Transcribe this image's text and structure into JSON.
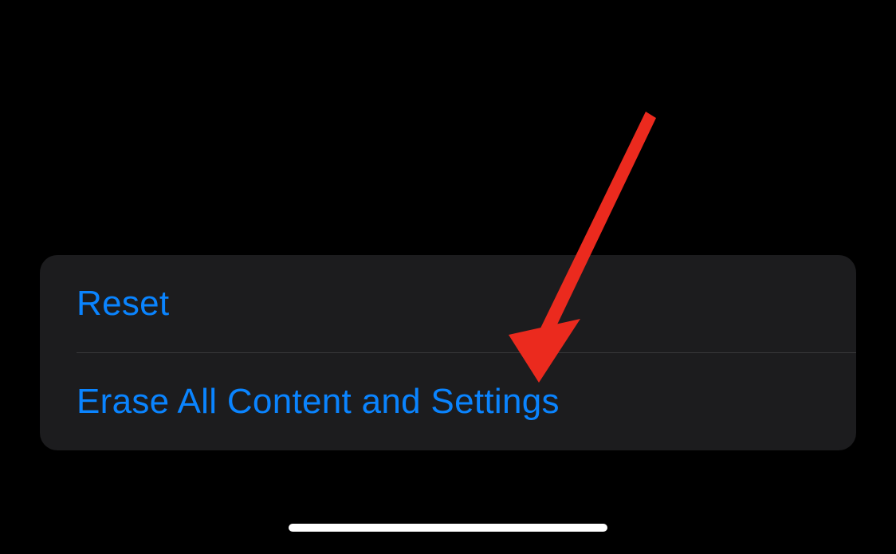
{
  "settings": {
    "group": {
      "reset_label": "Reset",
      "erase_label": "Erase All Content and Settings"
    }
  },
  "annotation": {
    "arrow_color": "#eb2a1e"
  }
}
